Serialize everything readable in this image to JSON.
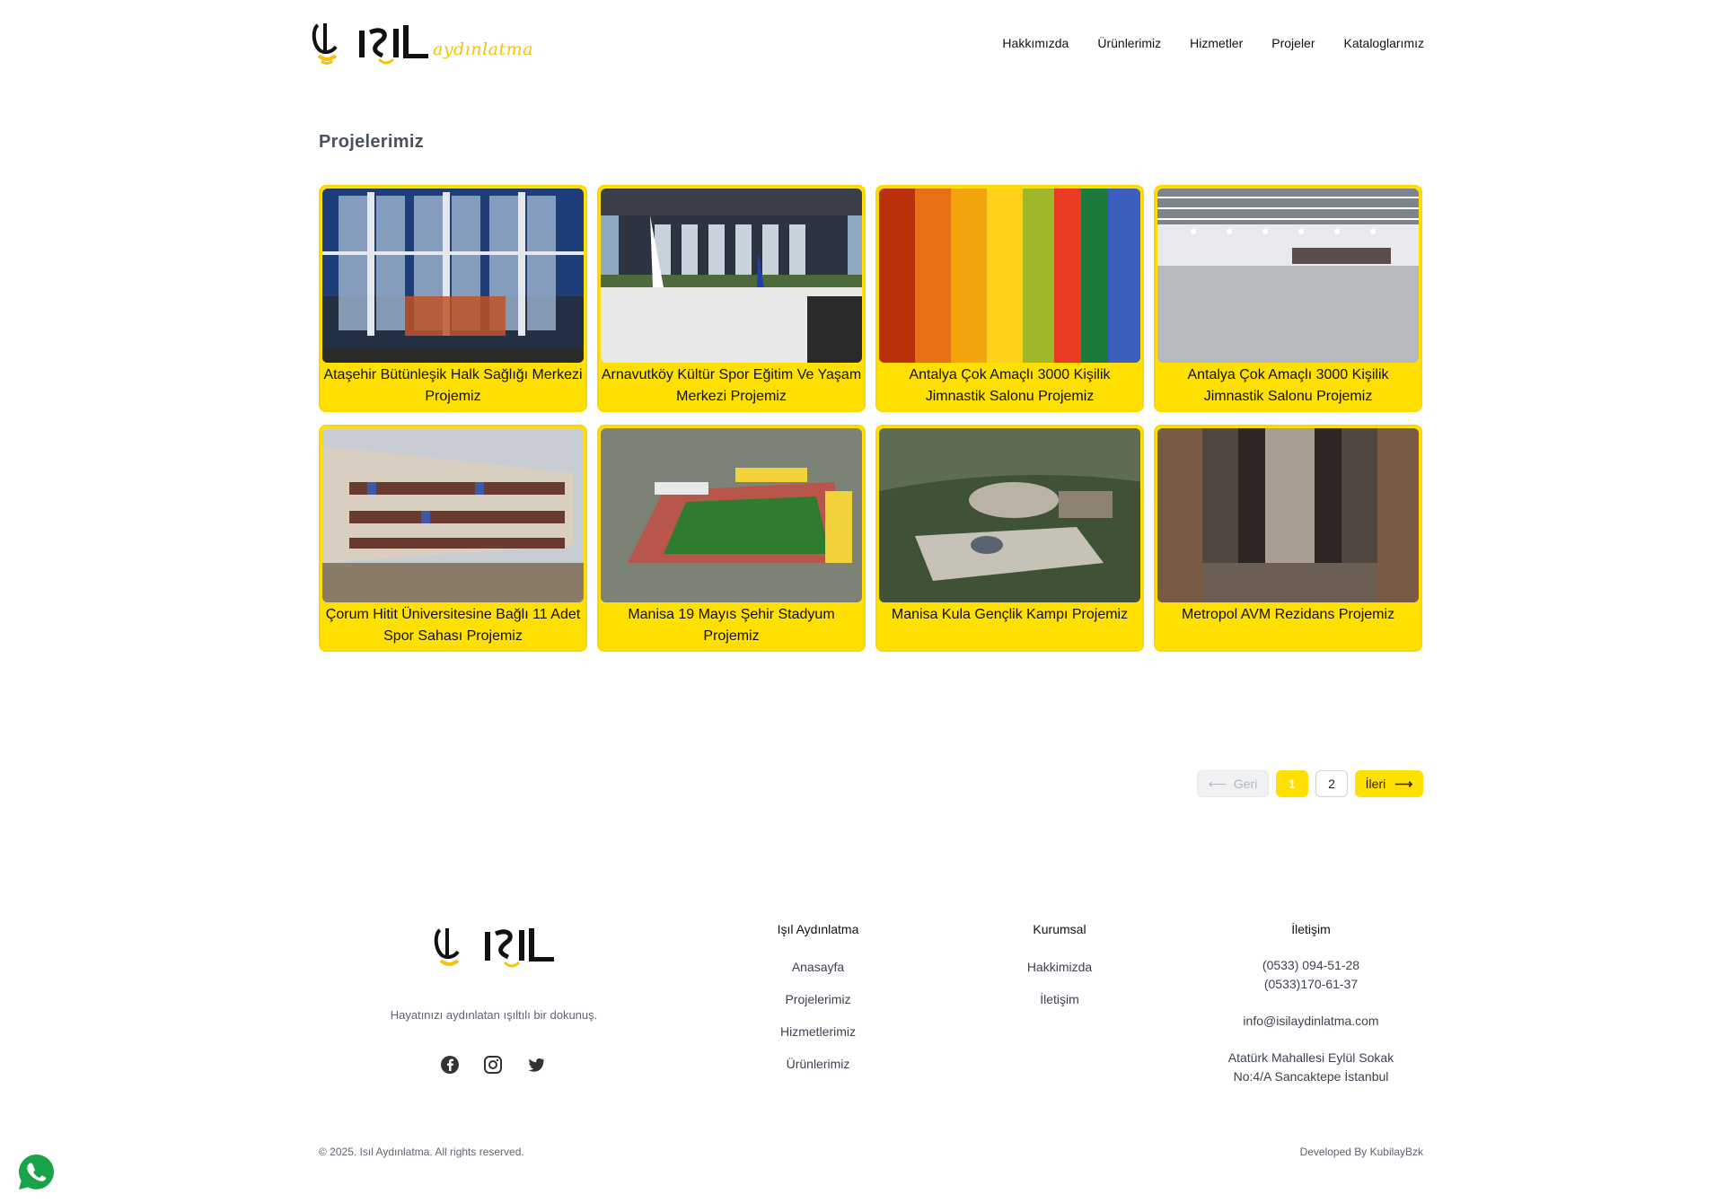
{
  "header": {
    "logo_text": "IŞIL",
    "logo_sub": "aydınlatma",
    "nav": [
      "Hakkımızda",
      "Ürünlerimiz",
      "Hizmetler",
      "Projeler",
      "Kataloglarımız"
    ]
  },
  "main": {
    "title": "Projelerimiz",
    "projects": [
      {
        "caption": "Ataşehir Bütünleşik Halk Sağlığı Merkezi Projemiz",
        "image": "building-facade-photo"
      },
      {
        "caption": "Arnavutköy Kültür Spor Eğitim Ve Yaşam Merkezi Projemiz",
        "image": "entrance-photo"
      },
      {
        "caption": "Antalya Çok Amaçlı 3000 Kişilik Jimnastik Salonu Projemiz",
        "image": "colorful-columns-photo"
      },
      {
        "caption": "Antalya Çok Amaçlı 3000 Kişilik Jimnastik Salonu Projemiz",
        "image": "sports-hall-photo"
      },
      {
        "caption": "Çorum Hitit Üniversitesine Bağlı 11 Adet Spor Sahası Projemiz",
        "image": "campus-building-photo"
      },
      {
        "caption": "Manisa 19 Mayıs Şehir Stadyum Projemiz",
        "image": "stadium-aerial-photo"
      },
      {
        "caption": "Manisa Kula Gençlik Kampı Projemiz",
        "image": "camp-render-photo"
      },
      {
        "caption": "Metropol AVM Rezidans Projemiz",
        "image": "corridor-photo"
      }
    ]
  },
  "pagination": {
    "prev": "Geri",
    "pages": [
      "1",
      "2"
    ],
    "next": "İleri",
    "current": "1"
  },
  "footer": {
    "logo_text": "IŞIL",
    "tagline": "Hayatınızı aydınlatan ışıltılı bir dokunuş.",
    "col1": {
      "title": "Işıl Aydınlatma",
      "links": [
        "Anasayfa",
        "Projelerimiz",
        "Hizmetlerimiz",
        "Ürünlerimiz"
      ]
    },
    "col2": {
      "title": "Kurumsal",
      "links": [
        "Hakkimizda",
        "İletişim"
      ]
    },
    "col3": {
      "title": "İletişim",
      "phone1": "(0533) 094-51-28",
      "phone2": "(0533)170-61-37",
      "email": "info@isilaydinlatma.com",
      "address1": "Atatürk Mahallesi Eylül Sokak",
      "address2": "No:4/A Sancaktepe İstanbul"
    },
    "copyright": "© 2025. Isıl Aydınlatma. All rights reserved.",
    "developed": "Developed By  KubilayBzk"
  },
  "colors": {
    "accent": "#ffe000",
    "title": "#4a5160"
  }
}
